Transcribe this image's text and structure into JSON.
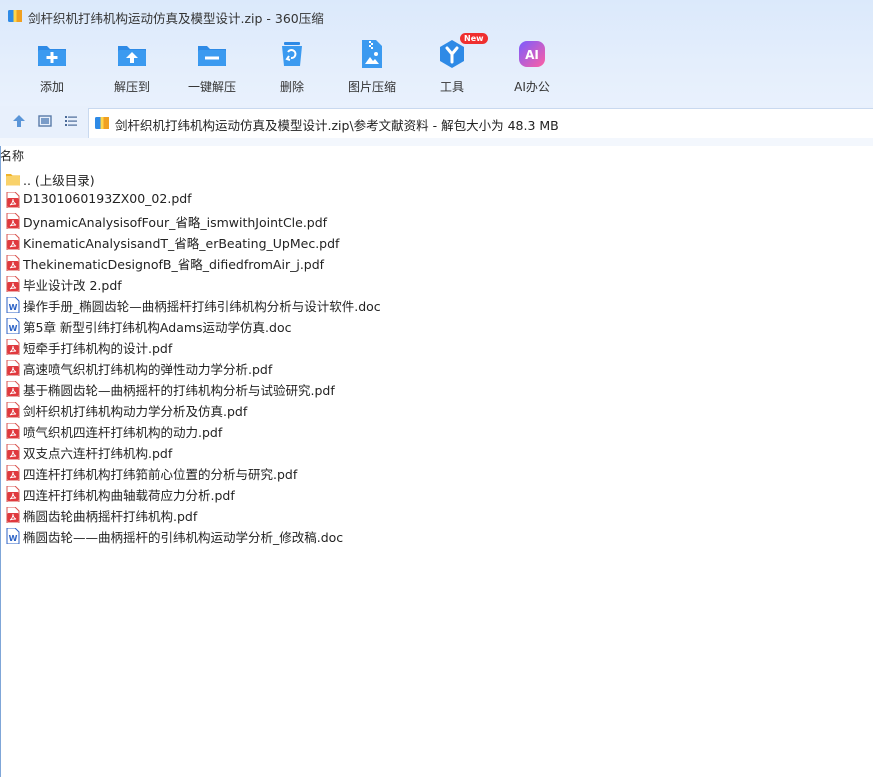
{
  "window": {
    "title": "剑杆织机打纬机构运动仿真及模型设计.zip - 360压缩"
  },
  "toolbar": [
    {
      "label": "添加",
      "icon": "add-folder-icon"
    },
    {
      "label": "解压到",
      "icon": "extract-to-icon"
    },
    {
      "label": "一键解压",
      "icon": "one-click-extract-icon"
    },
    {
      "label": "删除",
      "icon": "delete-icon"
    },
    {
      "label": "图片压缩",
      "icon": "image-compress-icon"
    },
    {
      "label": "工具",
      "icon": "tools-icon",
      "badge": "New"
    },
    {
      "label": "AI办公",
      "icon": "ai-office-icon",
      "glyph": "AI"
    }
  ],
  "address": {
    "path": "剑杆织机打纬机构运动仿真及模型设计.zip\\参考文献资料 - 解包大小为 48.3 MB"
  },
  "list": {
    "column_name": "名称",
    "items": [
      {
        "name": ".. (上级目录)",
        "type": "folder"
      },
      {
        "name": "D1301060193ZX00_02.pdf",
        "type": "pdf"
      },
      {
        "name": "DynamicAnalysisofFour_省略_ismwithJointCle.pdf",
        "type": "pdf"
      },
      {
        "name": "KinematicAnalysisandT_省略_erBeating_UpMec.pdf",
        "type": "pdf"
      },
      {
        "name": "ThekinematicDesignofB_省略_difiedfromAir_j.pdf",
        "type": "pdf"
      },
      {
        "name": "毕业设计改 2.pdf",
        "type": "pdf"
      },
      {
        "name": "操作手册_椭圆齿轮—曲柄摇杆打纬引纬机构分析与设计软件.doc",
        "type": "doc"
      },
      {
        "name": "第5章 新型引纬打纬机构Adams运动学仿真.doc",
        "type": "doc"
      },
      {
        "name": "短牵手打纬机构的设计.pdf",
        "type": "pdf"
      },
      {
        "name": "高速喷气织机打纬机构的弹性动力学分析.pdf",
        "type": "pdf"
      },
      {
        "name": "基于椭圆齿轮—曲柄摇杆的打纬机构分析与试验研究.pdf",
        "type": "pdf"
      },
      {
        "name": "剑杆织机打纬机构动力学分析及仿真.pdf",
        "type": "pdf"
      },
      {
        "name": "喷气织机四连杆打纬机构的动力.pdf",
        "type": "pdf"
      },
      {
        "name": "双支点六连杆打纬机构.pdf",
        "type": "pdf"
      },
      {
        "name": "四连杆打纬机构打纬筘前心位置的分析与研究.pdf",
        "type": "pdf"
      },
      {
        "name": "四连杆打纬机构曲轴载荷应力分析.pdf",
        "type": "pdf"
      },
      {
        "name": "椭圆齿轮曲柄摇杆打纬机构.pdf",
        "type": "pdf"
      },
      {
        "name": "椭圆齿轮——曲柄摇杆的引纬机构运动学分析_修改稿.doc",
        "type": "doc"
      }
    ]
  },
  "colors": {
    "accent": "#2e8ae6",
    "pdf": "#e0393e",
    "doc": "#2b62c6",
    "folder": "#f7c948",
    "ai_gradient": [
      "#7a5cff",
      "#ff5fa2"
    ]
  }
}
